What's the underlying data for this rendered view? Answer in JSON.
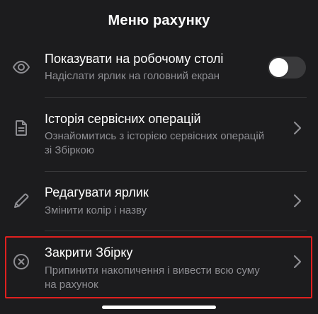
{
  "header": {
    "title": "Меню рахунку"
  },
  "menu": {
    "items": [
      {
        "label": "Показувати на робочому столі",
        "sublabel": "Надіслати ярлик на головний екран",
        "icon": "eye-icon",
        "control": "toggle",
        "toggle_on": false
      },
      {
        "label": "Історія сервісних операцій",
        "sublabel": "Ознайомитись з історією сервісних операцій зі Збіркою",
        "icon": "document-icon",
        "control": "chevron"
      },
      {
        "label": "Редагувати ярлик",
        "sublabel": "Змінити колір і назву",
        "icon": "pencil-icon",
        "control": "chevron"
      },
      {
        "label": "Закрити Збірку",
        "sublabel": "Припинити накопичення і вивести всю суму на рахунок",
        "icon": "close-circle-icon",
        "control": "chevron",
        "highlighted": true
      }
    ]
  },
  "colors": {
    "background": "#1c1c1e",
    "text_primary": "#ffffff",
    "text_secondary": "#8e8e93",
    "divider": "#38383a",
    "highlight_border": "#e0201f",
    "toggle_off": "#3a3a3c"
  }
}
